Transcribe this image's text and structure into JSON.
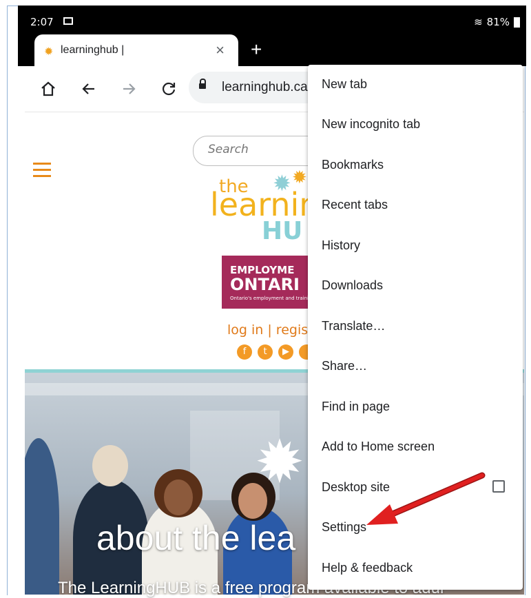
{
  "status": {
    "time": "2:07",
    "battery": "81%"
  },
  "tab": {
    "title": "learninghub |",
    "close": "×",
    "new_tab": "+"
  },
  "toolbar": {
    "url": "learninghub.ca"
  },
  "site": {
    "search_placeholder": "Search",
    "logo_the": "the",
    "logo_learning": "learnin",
    "logo_hub": "HU",
    "eo_line1": "EMPLOYME",
    "eo_line2": "ONTARI",
    "eo_line3": "Ontario's employment and training n",
    "login": "log in | regis",
    "hero_title": "about the lea",
    "hero_subtitle": "The LearningHUB is a free program available to adul"
  },
  "menu": {
    "items": [
      {
        "label": "New tab"
      },
      {
        "label": "New incognito tab"
      },
      {
        "label": "Bookmarks"
      },
      {
        "label": "Recent tabs"
      },
      {
        "label": "History"
      },
      {
        "label": "Downloads"
      },
      {
        "label": "Translate…"
      },
      {
        "label": "Share…"
      },
      {
        "label": "Find in page"
      },
      {
        "label": "Add to Home screen"
      },
      {
        "label": "Desktop site",
        "checkbox": false
      },
      {
        "label": "Settings"
      },
      {
        "label": "Help & feedback"
      }
    ]
  },
  "colors": {
    "accent_orange": "#e88a1a",
    "arrow_red": "#e02020",
    "eo_maroon": "#a52a5a"
  }
}
